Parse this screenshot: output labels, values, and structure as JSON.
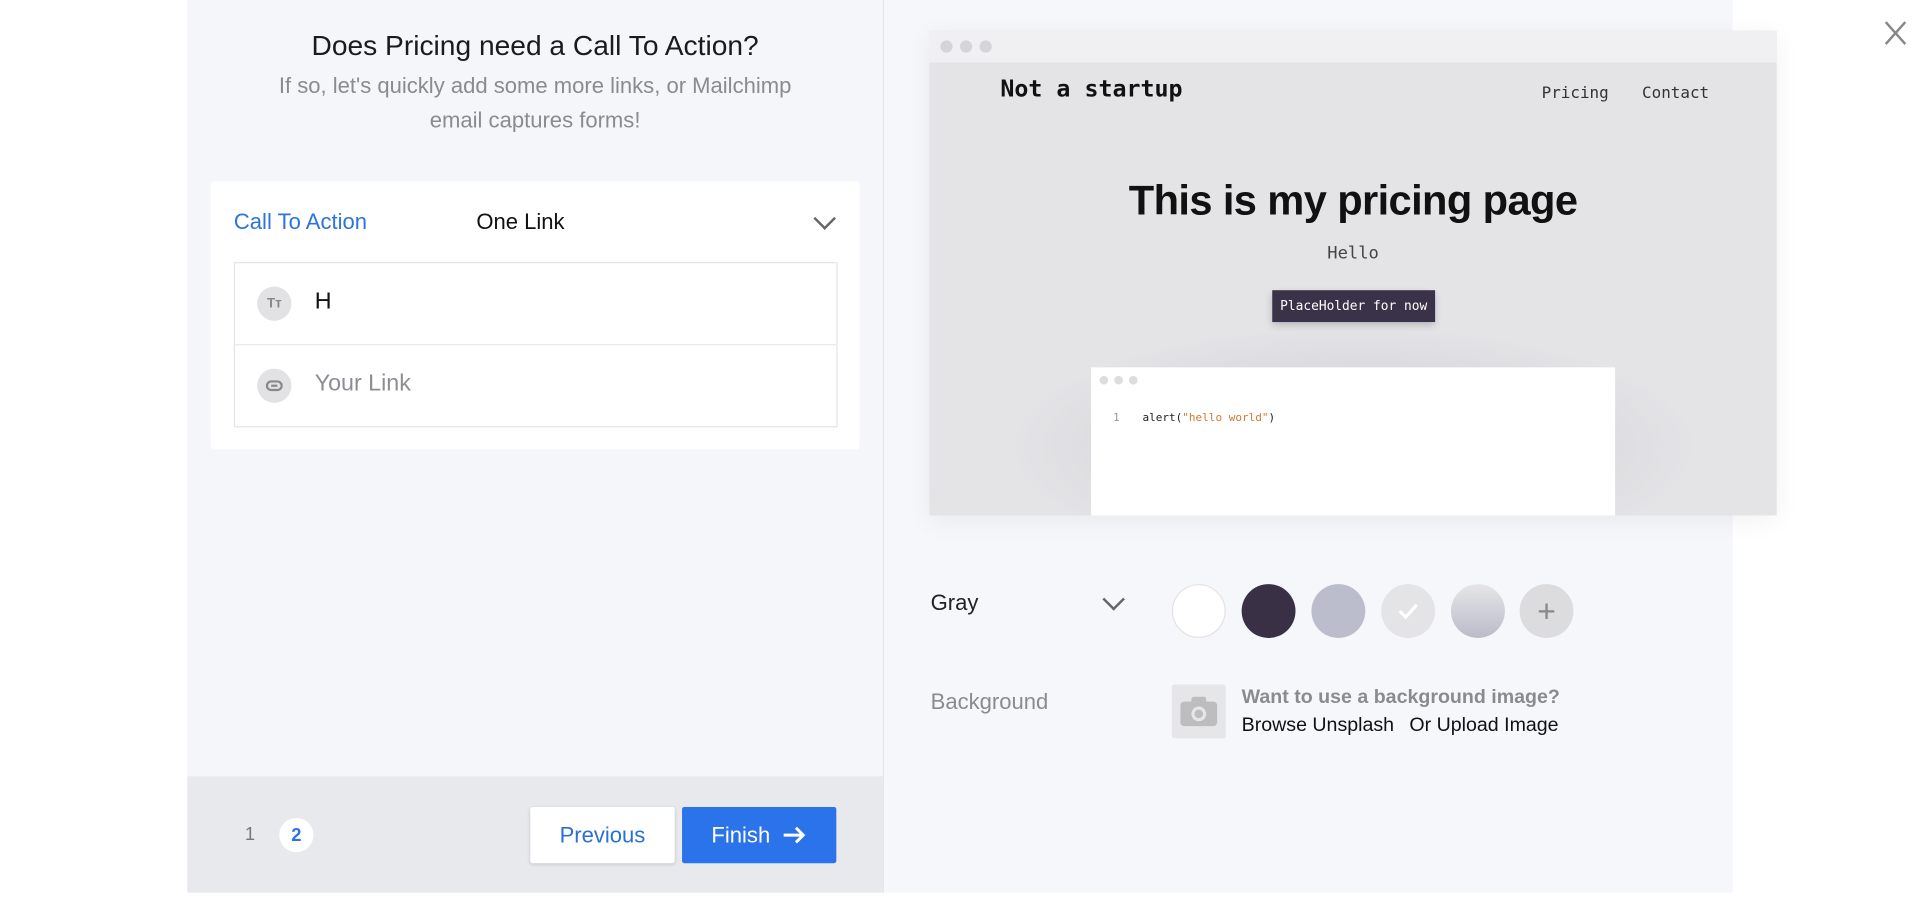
{
  "header": {
    "title": "Does Pricing need a Call To Action?",
    "subtitle_line1": "If so, let's quickly add some more links, or Mailchimp",
    "subtitle_line2": "email captures forms!"
  },
  "cta": {
    "label": "Call To Action",
    "selected": "One Link",
    "text_value": "H",
    "link_placeholder": "Your Link"
  },
  "pagination": {
    "pages": [
      "1",
      "2"
    ],
    "current": "2"
  },
  "buttons": {
    "previous": "Previous",
    "finish": "Finish"
  },
  "preview": {
    "brand": "Not a startup",
    "nav": [
      "Pricing",
      "Contact"
    ],
    "heading": "This is my pricing page",
    "subheading": "Hello",
    "button": "PlaceHolder for now",
    "code_line_number": "1",
    "code_fn": "alert(",
    "code_string": "\"hello world\"",
    "code_close": ")"
  },
  "theme": {
    "selected": "Gray",
    "swatches": [
      "#ffffff",
      "#3a3046",
      "#bbbdcc",
      "#e4e4e6",
      "gradient",
      "add"
    ],
    "selected_swatch_index": 3
  },
  "background": {
    "label": "Background",
    "prompt": "Want to use a background image?",
    "browse": "Browse Unsplash",
    "upload": "Or Upload Image"
  },
  "colors": {
    "accent": "#2a73ea"
  }
}
